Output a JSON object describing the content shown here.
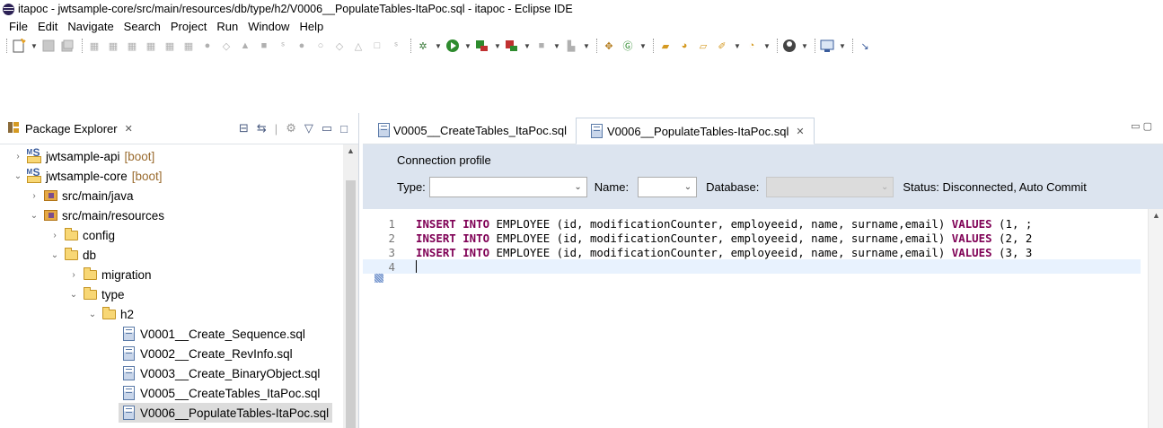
{
  "window": {
    "title": "itapoc - jwtsample-core/src/main/resources/db/type/h2/V0006__PopulateTables-ItaPoc.sql - itapoc - Eclipse IDE"
  },
  "menu": [
    "File",
    "Edit",
    "Navigate",
    "Search",
    "Project",
    "Run",
    "Window",
    "Help"
  ],
  "package_explorer": {
    "title": "Package Explorer",
    "tree": [
      {
        "label": "jwtsample-api",
        "decoration": "[boot]",
        "expanded": false,
        "icon": "maven-project-icon"
      },
      {
        "label": "jwtsample-core",
        "decoration": "[boot]",
        "expanded": true,
        "icon": "maven-project-icon"
      },
      {
        "label": "src/main/java",
        "expanded": false,
        "icon": "source-folder-icon"
      },
      {
        "label": "src/main/resources",
        "expanded": true,
        "icon": "source-folder-icon"
      },
      {
        "label": "config",
        "expanded": false,
        "icon": "folder-icon"
      },
      {
        "label": "db",
        "expanded": true,
        "icon": "folder-icon"
      },
      {
        "label": "migration",
        "expanded": false,
        "icon": "folder-icon"
      },
      {
        "label": "type",
        "expanded": true,
        "icon": "folder-icon"
      },
      {
        "label": "h2",
        "expanded": true,
        "icon": "folder-icon"
      },
      {
        "label": "V0001__Create_Sequence.sql",
        "icon": "sql-file-icon"
      },
      {
        "label": "V0002__Create_RevInfo.sql",
        "icon": "sql-file-icon"
      },
      {
        "label": "V0003__Create_BinaryObject.sql",
        "icon": "sql-file-icon"
      },
      {
        "label": "V0005__CreateTables_ItaPoc.sql",
        "icon": "sql-file-icon"
      },
      {
        "label": "V0006__PopulateTables-ItaPoc.sql",
        "icon": "sql-file-icon",
        "selected": true
      }
    ]
  },
  "editor": {
    "tabs": [
      {
        "label": "V0005__CreateTables_ItaPoc.sql",
        "active": false
      },
      {
        "label": "V0006__PopulateTables-ItaPoc.sql",
        "active": true
      }
    ],
    "connection_profile": {
      "title": "Connection profile",
      "type_label": "Type:",
      "type_value": "",
      "name_label": "Name:",
      "name_value": "",
      "database_label": "Database:",
      "database_value": "",
      "status": "Status: Disconnected, Auto Commit"
    },
    "lines": [
      {
        "num": "1",
        "keyword": "INSERT INTO",
        "text": " EMPLOYEE (id, modificationCounter, employeeid, name, surname,email) ",
        "keyword2": "VALUES",
        "tail": " (1, ;"
      },
      {
        "num": "2",
        "keyword": "INSERT INTO",
        "text": " EMPLOYEE (id, modificationCounter, employeeid, name, surname,email) ",
        "keyword2": "VALUES",
        "tail": " (2, 2"
      },
      {
        "num": "3",
        "keyword": "INSERT INTO",
        "text": " EMPLOYEE (id, modificationCounter, employeeid, name, surname,email) ",
        "keyword2": "VALUES",
        "tail": " (3, 3"
      },
      {
        "num": "4",
        "keyword": "",
        "text": "",
        "keyword2": "",
        "tail": ""
      }
    ]
  }
}
